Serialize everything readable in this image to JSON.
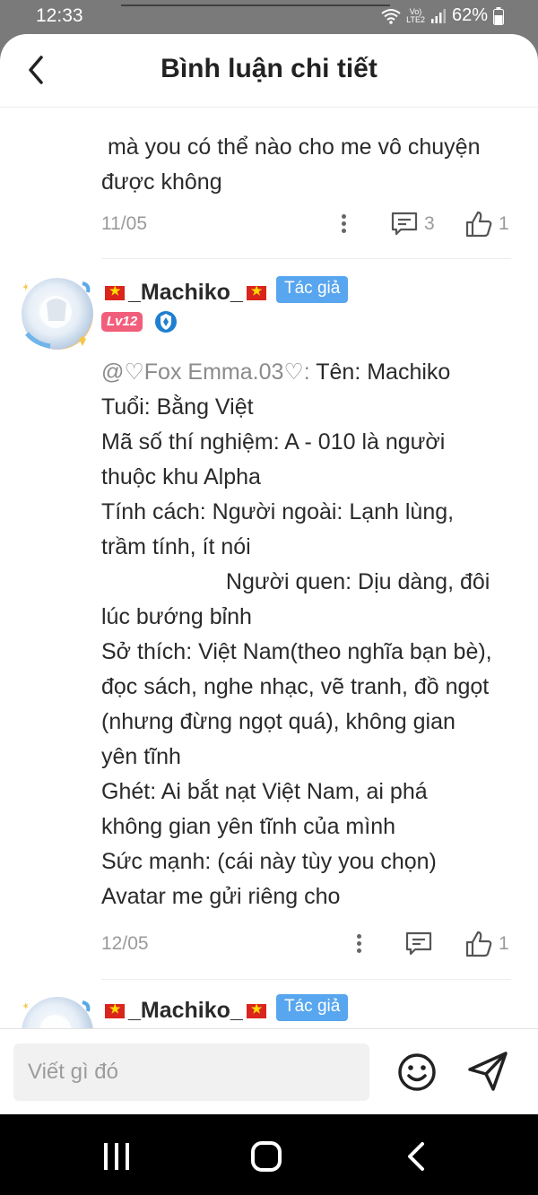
{
  "status_bar": {
    "time": "12:33",
    "network_top": "Vo)",
    "network_bottom": "LTE2",
    "battery": "62%"
  },
  "header": {
    "title": "Bình luận chi tiết"
  },
  "comment_1": {
    "lines": [
      " mà you có thể nào cho me vô chuyện",
      "được không"
    ],
    "date": "11/05",
    "reply_count": "3",
    "like_count": "1"
  },
  "comment_2": {
    "username": "_Machiko_",
    "author_badge": "Tác giả",
    "level": "Lv12",
    "mention": "@♡Fox Emma.03♡:",
    "first_line_rest": " Tên: Machiko",
    "lines": [
      "Tuổi: Bằng Việt",
      "Mã số thí nghiệm: A - 010 là người",
      "thuộc khu Alpha",
      "Tính cách: Người ngoài: Lạnh lùng,",
      "trầm tính, ít nói",
      "                    Người quen: Dịu dàng, đôi",
      "lúc bướng bỉnh",
      "Sở thích: Việt Nam(theo nghĩa bạn bè),",
      "đọc sách, nghe nhạc, vẽ tranh, đồ ngọt",
      "(nhưng đừng ngọt quá), không gian",
      "yên tĩnh",
      "Ghét: Ai bắt nạt Việt Nam, ai phá",
      "không gian yên tĩnh của mình",
      "Sức mạnh: (cái này tùy you chọn)",
      "Avatar me gửi riêng cho"
    ],
    "date": "12/05",
    "like_count": "1"
  },
  "comment_3": {
    "username": "_Machiko_",
    "author_badge": "Tác giả"
  },
  "input_bar": {
    "placeholder": "Viết gì đó"
  },
  "colors": {
    "author_badge": "#58a6ef",
    "level_badge": "#f15e7b",
    "accent_text": "#2a2a2a"
  }
}
